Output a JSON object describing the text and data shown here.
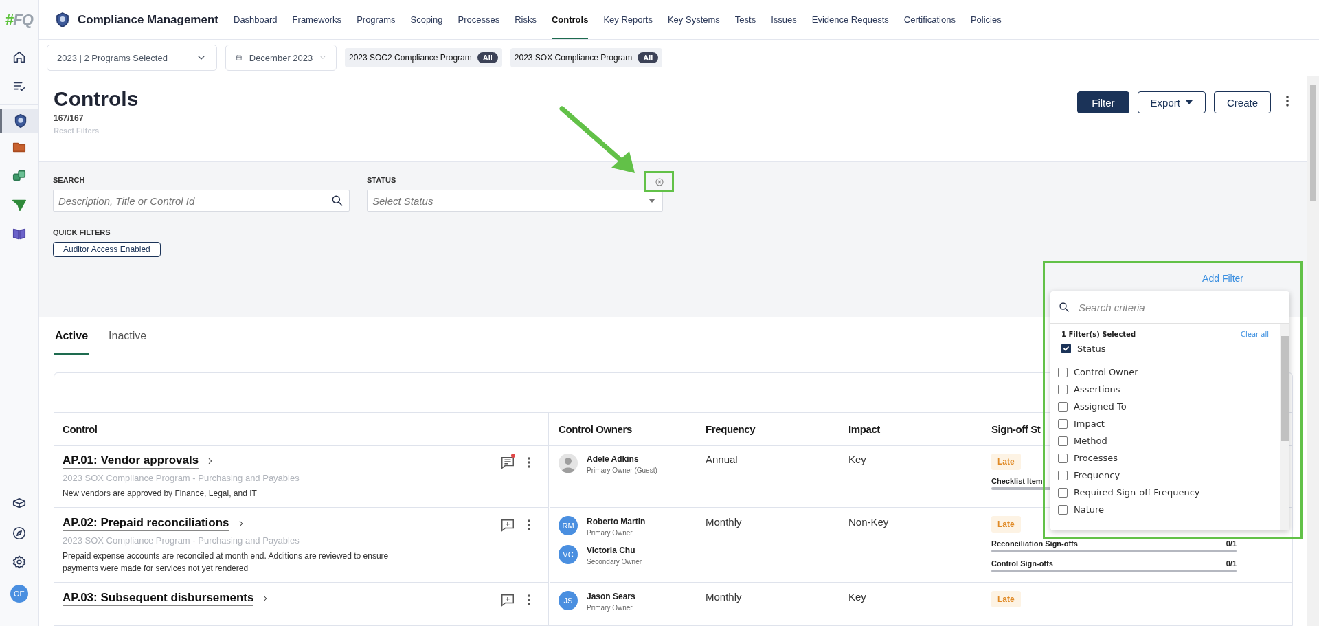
{
  "sidebar": {
    "logo": {
      "mark": "#",
      "text": "FQ"
    },
    "avatar": "OE"
  },
  "app": {
    "title": "Compliance Management"
  },
  "nav": [
    {
      "label": "Dashboard",
      "selected": false
    },
    {
      "label": "Frameworks",
      "selected": false
    },
    {
      "label": "Programs",
      "selected": false
    },
    {
      "label": "Scoping",
      "selected": false
    },
    {
      "label": "Processes",
      "selected": false
    },
    {
      "label": "Risks",
      "selected": false
    },
    {
      "label": "Controls",
      "selected": true
    },
    {
      "label": "Key Reports",
      "selected": false
    },
    {
      "label": "Key Systems",
      "selected": false
    },
    {
      "label": "Tests",
      "selected": false
    },
    {
      "label": "Issues",
      "selected": false
    },
    {
      "label": "Evidence Requests",
      "selected": false
    },
    {
      "label": "Certifications",
      "selected": false
    },
    {
      "label": "Policies",
      "selected": false
    }
  ],
  "context_bar": {
    "program_select": "2023 | 2 Programs Selected",
    "period_select": "December 2023",
    "programs": [
      {
        "name": "2023 SOC2 Compliance Program",
        "badge": "All"
      },
      {
        "name": "2023 SOX Compliance Program",
        "badge": "All"
      }
    ]
  },
  "page": {
    "title": "Controls",
    "count": "167/167",
    "reset": "Reset Filters",
    "filter_button": "Filter",
    "export_button": "Export",
    "create_button": "Create"
  },
  "filters": {
    "search": {
      "label": "SEARCH",
      "placeholder": "Description, Title or Control Id"
    },
    "status": {
      "label": "STATUS",
      "placeholder": "Select Status"
    },
    "quick_filters": {
      "label": "QUICK FILTERS",
      "chips": [
        "Auditor Access Enabled"
      ]
    },
    "add_filter": "Add Filter"
  },
  "filter_menu": {
    "placeholder": "Search criteria",
    "selected_count": "1 Filter(s) Selected",
    "clear": "Clear all",
    "selected": [
      {
        "label": "Status",
        "checked": true
      }
    ],
    "options": [
      {
        "label": "Control Owner",
        "checked": false
      },
      {
        "label": "Assertions",
        "checked": false
      },
      {
        "label": "Assigned To",
        "checked": false
      },
      {
        "label": "Impact",
        "checked": false
      },
      {
        "label": "Method",
        "checked": false
      },
      {
        "label": "Processes",
        "checked": false
      },
      {
        "label": "Frequency",
        "checked": false
      },
      {
        "label": "Required Sign-off Frequency",
        "checked": false
      },
      {
        "label": "Nature",
        "checked": false
      }
    ]
  },
  "tabs": [
    {
      "label": "Active",
      "selected": true
    },
    {
      "label": "Inactive",
      "selected": false
    }
  ],
  "table": {
    "columns": [
      "Control",
      "Control Owners",
      "Frequency",
      "Impact",
      "Sign-off St"
    ],
    "rows": [
      {
        "title": "AP.01: Vendor approvals",
        "program": "2023 SOX Compliance Program - Purchasing and Payables",
        "description": "New vendors are approved by Finance, Legal, and IT",
        "has_comments": true,
        "owners": [
          {
            "kind": "photo",
            "name": "Adele Adkins",
            "role": "Primary Owner (Guest)"
          }
        ],
        "frequency": "Annual",
        "impact": "Key",
        "status": "Late",
        "signoffs": [
          {
            "label": "Checklist Item"
          }
        ]
      },
      {
        "title": "AP.02: Prepaid reconciliations",
        "program": "2023 SOX Compliance Program - Purchasing and Payables",
        "description": "Prepaid expense accounts are reconciled at month end. Additions are reviewed to ensure payments were made for services not yet rendered",
        "has_comments": false,
        "owners": [
          {
            "kind": "initials",
            "initials": "RM",
            "name": "Roberto Martin",
            "role": "Primary Owner"
          },
          {
            "kind": "initials",
            "initials": "VC",
            "name": "Victoria Chu",
            "role": "Secondary Owner"
          }
        ],
        "frequency": "Monthly",
        "impact": "Non-Key",
        "status": "Late",
        "signoffs": [
          {
            "label": "Reconciliation Sign-offs",
            "count": "0/1"
          },
          {
            "label": "Control Sign-offs",
            "count": "0/1"
          }
        ]
      },
      {
        "title": "AP.03: Subsequent disbursements",
        "has_comments": false,
        "owners": [
          {
            "kind": "initials",
            "initials": "JS",
            "name": "Jason Sears",
            "role": "Primary Owner"
          }
        ],
        "frequency": "Monthly",
        "impact": "Key",
        "status": "Late"
      }
    ]
  }
}
